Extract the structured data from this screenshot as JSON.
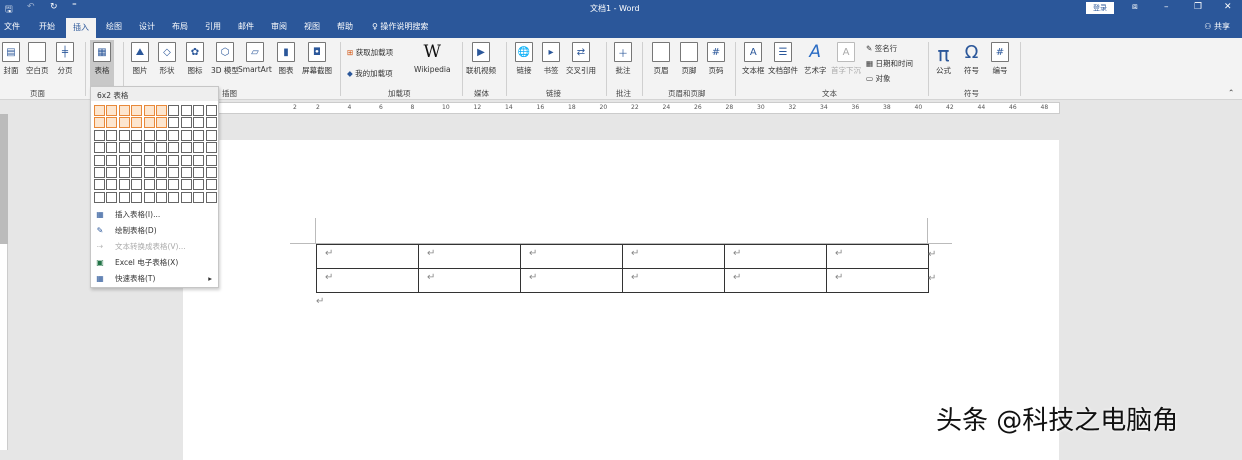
{
  "title": "文档1 - Word",
  "login": "登录",
  "share": "共享",
  "tabs": [
    "文件",
    "开始",
    "插入",
    "绘图",
    "设计",
    "布局",
    "引用",
    "邮件",
    "审阅",
    "视图",
    "帮助",
    "操作说明搜索"
  ],
  "ribbon": {
    "cover": "封面",
    "blank": "空白页",
    "pagebreak": "分页",
    "table": "表格",
    "picture": "图片",
    "shapes": "形状",
    "icons": "图标",
    "model3d": "3D 模型",
    "smartart": "SmartArt",
    "chart": "图表",
    "screenshot": "屏幕截图",
    "getaddins": "获取加载项",
    "myaddins": "我的加载项",
    "wikipedia": "Wikipedia",
    "video": "联机视频",
    "link": "链接",
    "bookmark": "书签",
    "crossref": "交叉引用",
    "comment": "批注",
    "header": "页眉",
    "footer": "页脚",
    "pagenum": "页码",
    "textbox": "文本框",
    "quickparts": "文档部件",
    "wordart": "艺术字",
    "dropcap": "首字下沉",
    "sigline": "签名行",
    "datetime": "日期和时间",
    "object": "对象",
    "equation": "公式",
    "symbol": "符号",
    "number": "编号",
    "groups": {
      "pages": "页面",
      "illus": "插图",
      "addins": "加载项",
      "media": "媒体",
      "links": "链接",
      "comments": "批注",
      "hf": "页眉和页脚",
      "text": "文本",
      "symbols": "符号"
    }
  },
  "ruler": [
    "2",
    "2",
    "4",
    "6",
    "8",
    "10",
    "12",
    "14",
    "16",
    "18",
    "20",
    "22",
    "24",
    "26",
    "28",
    "30",
    "32",
    "34",
    "36",
    "38",
    "40",
    "42",
    "44",
    "46",
    "48"
  ],
  "menu": {
    "header": "6x2 表格",
    "cols": 10,
    "rows": 8,
    "sel_cols": 6,
    "sel_rows": 2,
    "items": [
      "插入表格(I)...",
      "绘制表格(D)",
      "文本转换成表格(V)...",
      "Excel 电子表格(X)",
      "快速表格(T)"
    ]
  },
  "table": {
    "rows": 2,
    "cols": 6,
    "mark": "↵"
  },
  "watermark": "头条 @科技之电脑角"
}
